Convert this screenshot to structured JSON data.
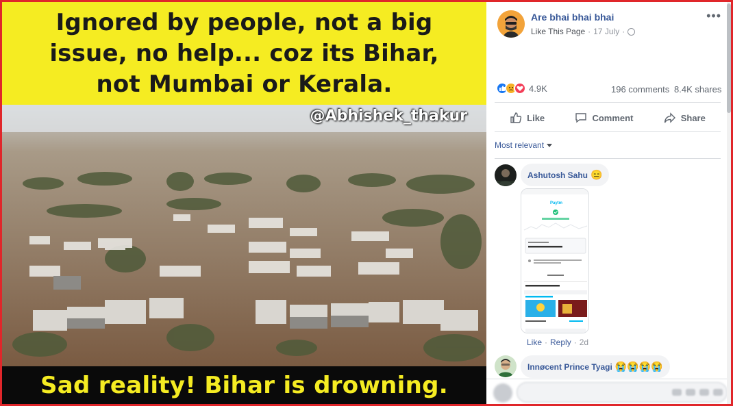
{
  "post_image": {
    "top_caption": "Ignored by people, not a big issue, no help... coz its Bihar, not Mumbai or Kerala.",
    "watermark": "@Abhishek_thakur",
    "bottom_caption": "Sad reality! Bihar is drowning."
  },
  "post": {
    "page_name": "Are bhai bhai bhai",
    "like_link": "Like This Page",
    "separator": "·",
    "date": "17 July",
    "more": "•••",
    "avatar_icon": "masked-man-avatar",
    "privacy_icon": "globe-icon"
  },
  "stats": {
    "reactions": "4.9K",
    "comments": "196 comments",
    "shares": "8.4K shares",
    "reaction_types": [
      "like",
      "sad",
      "love"
    ]
  },
  "actions": {
    "like": "Like",
    "comment": "Comment",
    "share": "Share"
  },
  "sort": {
    "label": "Most relevant"
  },
  "comments": [
    {
      "author": "Ashutosh Sahu",
      "emoji": "😑",
      "has_image": true,
      "like_link": "Like",
      "reply_link": "Reply",
      "separator": "·",
      "age": "2d"
    },
    {
      "author": "Innøcent Prince Tyagi",
      "emoji": "😭😭😭😭"
    }
  ],
  "colors": {
    "link_blue": "#385898",
    "meme_yellow": "#f5ec22",
    "frame_red": "#e0262a"
  }
}
